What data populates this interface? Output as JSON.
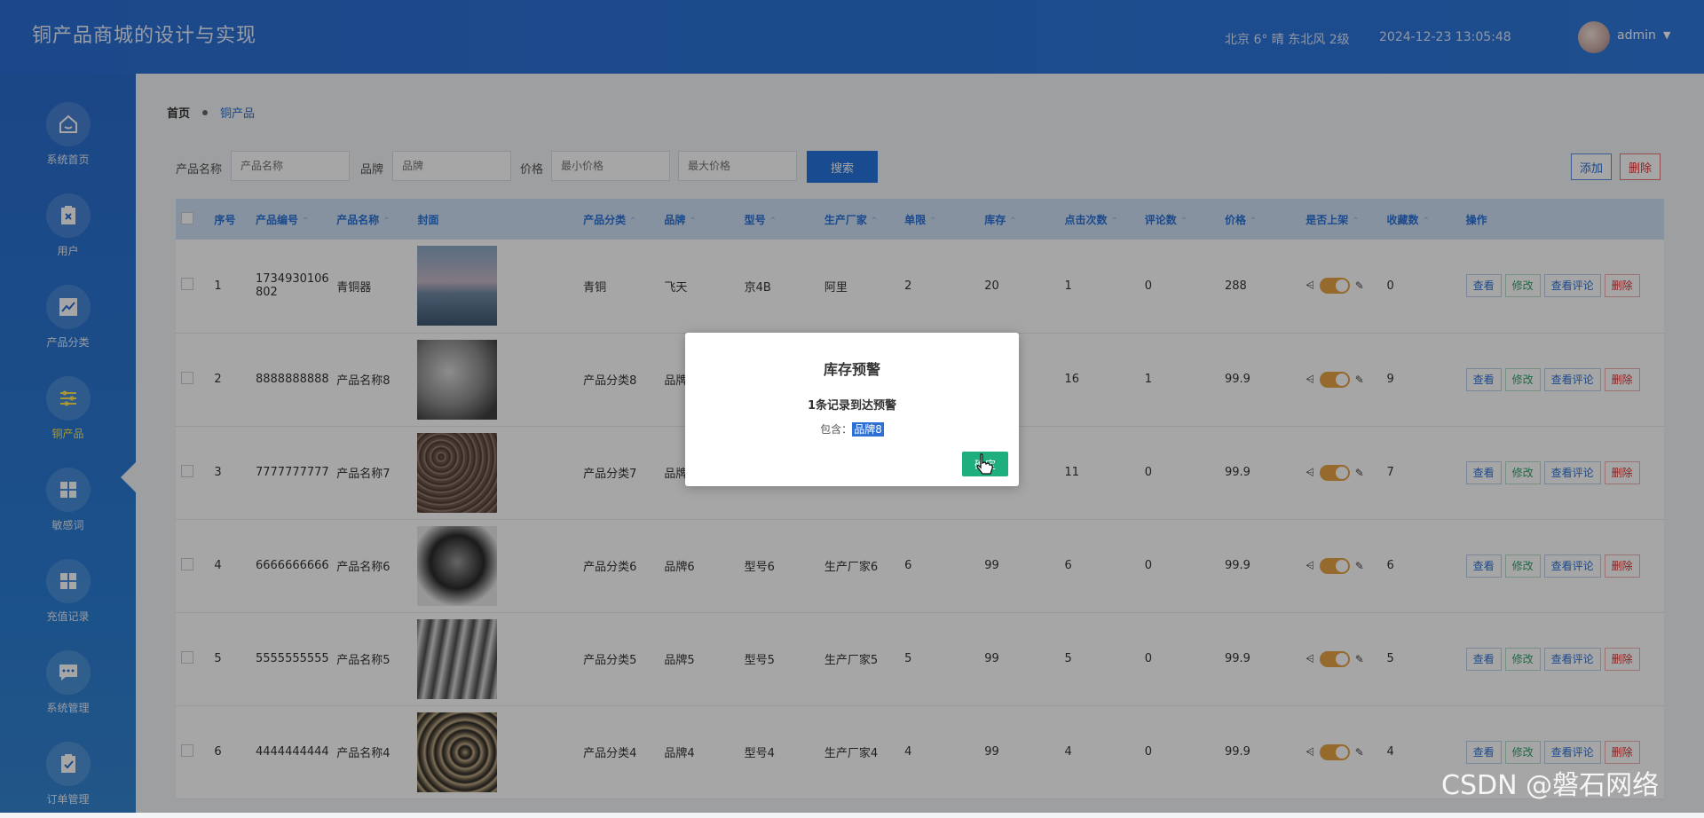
{
  "header": {
    "title": "铜产品商城的设计与实现",
    "weather": "北京  6°  晴  东北风  2级",
    "datetime": "2024-12-23 13:05:48",
    "user": "admin",
    "caret": "▼"
  },
  "sidebar": {
    "items": [
      {
        "label": "系统首页",
        "icon": "home-icon"
      },
      {
        "label": "用户",
        "icon": "clipboard-x-icon"
      },
      {
        "label": "产品分类",
        "icon": "line-chart-icon"
      },
      {
        "label": "铜产品",
        "icon": "sliders-icon"
      },
      {
        "label": "敏感词",
        "icon": "grid-icon"
      },
      {
        "label": "充值记录",
        "icon": "grid-icon"
      },
      {
        "label": "系统管理",
        "icon": "chat-icon"
      },
      {
        "label": "订单管理",
        "icon": "clipboard-check-icon"
      }
    ],
    "active_index": 3
  },
  "breadcrumb": {
    "home": "首页",
    "current": "铜产品"
  },
  "search": {
    "name_label": "产品名称",
    "name_placeholder": "产品名称",
    "brand_label": "品牌",
    "brand_placeholder": "品牌",
    "price_label": "价格",
    "min_placeholder": "最小价格",
    "max_placeholder": "最大价格",
    "search_button": "搜索"
  },
  "actions": {
    "add": "添加",
    "delete": "删除"
  },
  "table": {
    "columns": [
      "序号",
      "产品编号",
      "产品名称",
      "封面",
      "产品分类",
      "品牌",
      "型号",
      "生产厂家",
      "单限",
      "库存",
      "点击次数",
      "评论数",
      "价格",
      "是否上架",
      "收藏数",
      "操作"
    ],
    "ops": {
      "view": "查看",
      "edit": "修改",
      "comments": "查看评论",
      "delete": "删除"
    },
    "rows": [
      {
        "no": "1",
        "code": "1734930106802",
        "name": "青铜器",
        "cover": "sunset",
        "category": "青铜",
        "brand": "飞天",
        "model": "京4B",
        "maker": "阿里",
        "limit": "2",
        "stock": "20",
        "clicks": "1",
        "comments": "0",
        "price": "288",
        "favs": "0"
      },
      {
        "no": "2",
        "code": "8888888888",
        "name": "产品名称8",
        "cover": "ore-gray",
        "category": "产品分类8",
        "brand": "品牌8",
        "model": "",
        "maker": "",
        "limit": "",
        "stock": "",
        "clicks": "16",
        "comments": "1",
        "price": "99.9",
        "favs": "9"
      },
      {
        "no": "3",
        "code": "7777777777",
        "name": "产品名称7",
        "cover": "gravel",
        "category": "产品分类7",
        "brand": "品牌7",
        "model": "",
        "maker": "",
        "limit": "",
        "stock": "",
        "clicks": "11",
        "comments": "0",
        "price": "99.9",
        "favs": "7"
      },
      {
        "no": "4",
        "code": "6666666666",
        "name": "产品名称6",
        "cover": "ore-black",
        "category": "产品分类6",
        "brand": "品牌6",
        "model": "型号6",
        "maker": "生产厂家6",
        "limit": "6",
        "stock": "99",
        "clicks": "6",
        "comments": "0",
        "price": "99.9",
        "favs": "6"
      },
      {
        "no": "5",
        "code": "5555555555",
        "name": "产品名称5",
        "cover": "rods",
        "category": "产品分类5",
        "brand": "品牌5",
        "model": "型号5",
        "maker": "生产厂家5",
        "limit": "5",
        "stock": "99",
        "clicks": "5",
        "comments": "0",
        "price": "99.9",
        "favs": "5"
      },
      {
        "no": "6",
        "code": "4444444444",
        "name": "产品名称4",
        "cover": "scrap",
        "category": "产品分类4",
        "brand": "品牌4",
        "model": "型号4",
        "maker": "生产厂家4",
        "limit": "4",
        "stock": "99",
        "clicks": "4",
        "comments": "0",
        "price": "99.9",
        "favs": "4"
      }
    ]
  },
  "dialog": {
    "title": "库存预警",
    "message": "1条记录到达预警",
    "include_label": "包含：",
    "include_value": "品牌8",
    "ok_button": "确定"
  },
  "watermark": "CSDN @磐石网络",
  "colors": {
    "header": "#2a6fd4",
    "accent": "#2673dc",
    "active_nav": "#ffe84d",
    "ok_button": "#1fae7e",
    "delete": "#dd3333"
  }
}
